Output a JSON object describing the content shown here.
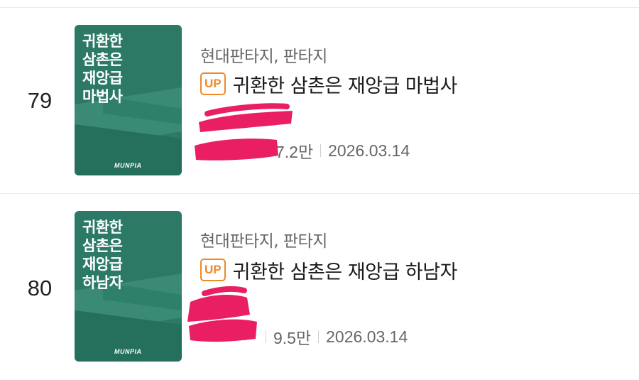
{
  "items": [
    {
      "rank": "79",
      "cover_title": [
        "귀환한",
        "삼촌은",
        "재앙급",
        "마법사"
      ],
      "publisher_logo": "MUNPIA",
      "genre": "현대판타지, 판타지",
      "badge": "UP",
      "title": "귀환한 삼촌은 재앙급 마법사",
      "views": "7.2만",
      "date": "2026.03.14"
    },
    {
      "rank": "80",
      "cover_title": [
        "귀환한",
        "삼촌은",
        "재앙급",
        "하남자"
      ],
      "publisher_logo": "MUNPIA",
      "genre": "현대판타지, 판타지",
      "badge": "UP",
      "title": "귀환한 삼촌은 재앙급 하남자",
      "views": "9.5만",
      "date": "2026.03.14"
    }
  ],
  "colors": {
    "cover": "#2c7a66",
    "badge": "#ee8a2b",
    "redaction": "#e91e63"
  }
}
